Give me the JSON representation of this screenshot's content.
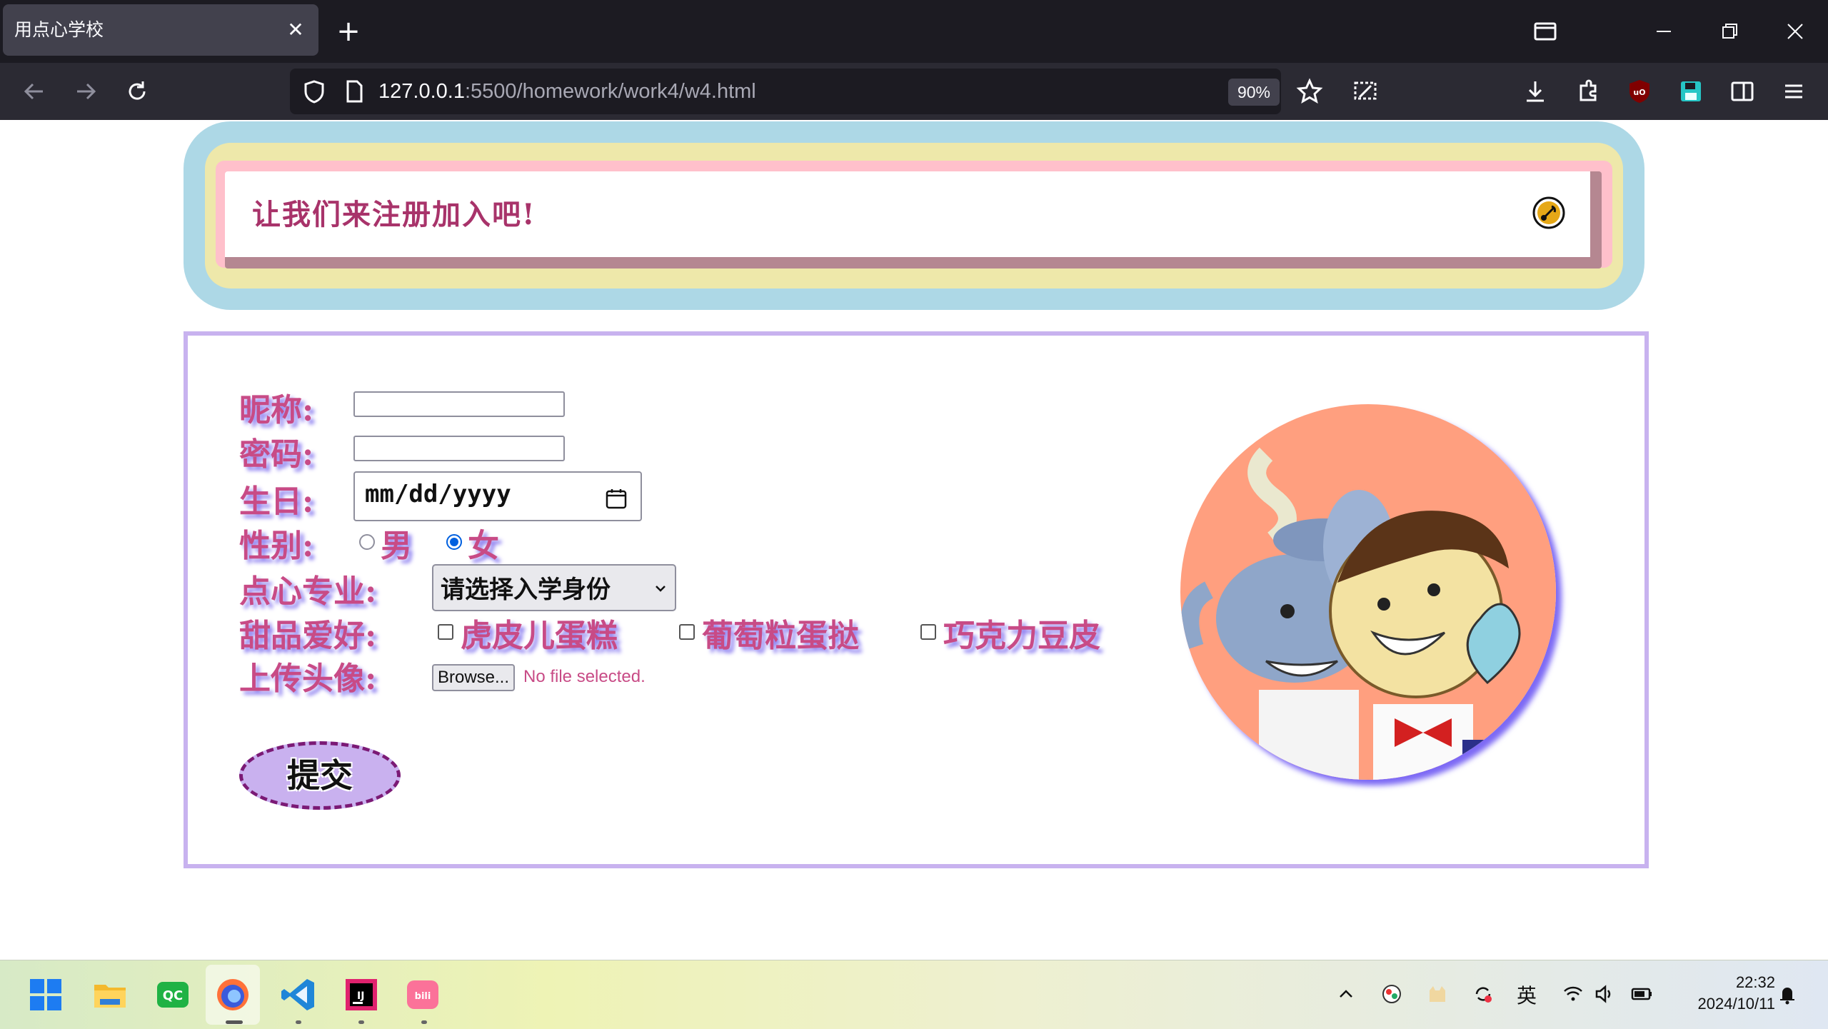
{
  "browser": {
    "tab_title": "用点心学校",
    "tab_close": "✕",
    "new_tab": "+",
    "url_host": "127.0.0.1",
    "url_rest": ":5500/homework/work4/w4.html",
    "zoom": "90%"
  },
  "banner": {
    "title": "让我们来注册加入吧!"
  },
  "form": {
    "nickname_label": "昵称:",
    "password_label": "密码:",
    "birthday_label": "生日:",
    "birthday_placeholder": "mm/dd/yyyy",
    "gender_label": "性别:",
    "gender_options": [
      "男",
      "女"
    ],
    "gender_selected": "女",
    "major_label": "点心专业:",
    "major_select_value": "请选择入学身份",
    "hobby_label": "甜品爱好:",
    "hobby_options": [
      "虎皮儿蛋糕",
      "葡萄粒蛋挞",
      "巧克力豆皮"
    ],
    "upload_label": "上传头像:",
    "browse_button": "Browse...",
    "no_file_text": "No file selected.",
    "submit_label": "提交"
  },
  "taskbar": {
    "ime": "英",
    "time": "22:32",
    "date": "2024/10/11"
  },
  "colors": {
    "label_pink": "#c84b86",
    "label_shadow": "#8a7cf0",
    "banner_blue": "#add8e6",
    "banner_yellow": "#eee8aa",
    "banner_pink": "#ffc0cb",
    "form_border": "#c8b2ef",
    "submit_bg": "#c9b1ef",
    "avatar_bg": "#ff9f7f"
  }
}
